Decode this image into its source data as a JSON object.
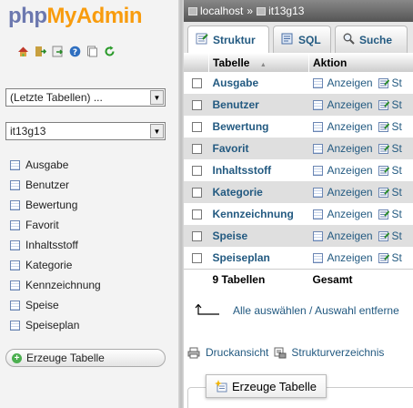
{
  "logo": {
    "part1": "php",
    "part2": "MyAdmin"
  },
  "nav_icons": [
    "home-icon",
    "logout-icon",
    "query-window-icon",
    "help-icon",
    "docs-icon",
    "reload-icon"
  ],
  "recent_select": {
    "selected": "(Letzte Tabellen) ..."
  },
  "db_select": {
    "selected": "it13g13"
  },
  "tables": [
    "Ausgabe",
    "Benutzer",
    "Bewertung",
    "Favorit",
    "Inhaltsstoff",
    "Kategorie",
    "Kennzeichnung",
    "Speise",
    "Speiseplan"
  ],
  "create_table_left": "Erzeuge Tabelle",
  "breadcrumb": {
    "server": "localhost",
    "separator": "»",
    "database": "it13g13"
  },
  "tabs": [
    {
      "label": "Struktur",
      "icon": "structure-icon",
      "active": true
    },
    {
      "label": "SQL",
      "icon": "sql-icon",
      "active": false
    },
    {
      "label": "Suche",
      "icon": "search-icon",
      "active": false
    }
  ],
  "table_header": {
    "table": "Tabelle",
    "sort_indicator": "▲",
    "action": "Aktion"
  },
  "rows": [
    {
      "name": "Ausgabe",
      "browse": "Anzeigen",
      "structure": "St"
    },
    {
      "name": "Benutzer",
      "browse": "Anzeigen",
      "structure": "St"
    },
    {
      "name": "Bewertung",
      "browse": "Anzeigen",
      "structure": "St"
    },
    {
      "name": "Favorit",
      "browse": "Anzeigen",
      "structure": "St"
    },
    {
      "name": "Inhaltsstoff",
      "browse": "Anzeigen",
      "structure": "St"
    },
    {
      "name": "Kategorie",
      "browse": "Anzeigen",
      "structure": "St"
    },
    {
      "name": "Kennzeichnung",
      "browse": "Anzeigen",
      "structure": "St"
    },
    {
      "name": "Speise",
      "browse": "Anzeigen",
      "structure": "St"
    },
    {
      "name": "Speiseplan",
      "browse": "Anzeigen",
      "structure": "St"
    }
  ],
  "footer": {
    "count": "9 Tabellen",
    "total": "Gesamt"
  },
  "check_all": "Alle auswählen / Auswahl entferne",
  "print_view": "Druckansicht",
  "data_dictionary": "Strukturverzeichnis",
  "create_table_right": "Erzeuge Tabelle",
  "colors": {
    "link": "#235a81",
    "logo_php": "#6c78af",
    "logo_myadmin": "#f89c0e",
    "row_alt": "#dfdfdf"
  }
}
